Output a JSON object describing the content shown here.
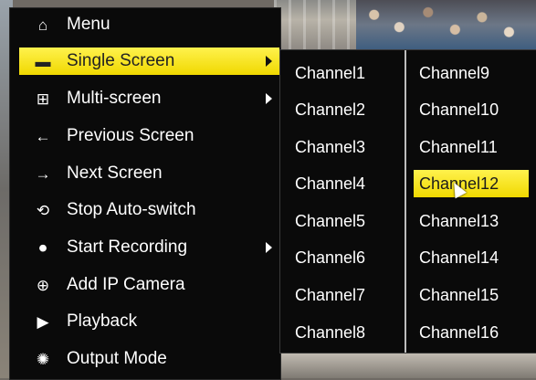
{
  "menu": {
    "items": [
      {
        "label": "Menu",
        "icon": "home-icon",
        "glyph": "⌂",
        "has_submenu": false,
        "selected": false
      },
      {
        "label": "Single Screen",
        "icon": "single-screen-icon",
        "glyph": "▬",
        "has_submenu": true,
        "selected": true
      },
      {
        "label": "Multi-screen",
        "icon": "multi-screen-icon",
        "glyph": "⊞",
        "has_submenu": true,
        "selected": false
      },
      {
        "label": "Previous Screen",
        "icon": "arrow-left-icon",
        "glyph": "←",
        "has_submenu": false,
        "selected": false
      },
      {
        "label": "Next Screen",
        "icon": "arrow-right-icon",
        "glyph": "→",
        "has_submenu": false,
        "selected": false
      },
      {
        "label": "Stop Auto-switch",
        "icon": "stop-auto-switch-icon",
        "glyph": "⟲",
        "has_submenu": false,
        "selected": false
      },
      {
        "label": "Start Recording",
        "icon": "record-icon",
        "glyph": "⏺",
        "has_submenu": true,
        "selected": false
      },
      {
        "label": "Add IP Camera",
        "icon": "add-camera-icon",
        "glyph": "⊕",
        "has_submenu": false,
        "selected": false
      },
      {
        "label": "Playback",
        "icon": "playback-icon",
        "glyph": "▶",
        "has_submenu": false,
        "selected": false
      },
      {
        "label": "Output Mode",
        "icon": "output-mode-icon",
        "glyph": "✺",
        "has_submenu": false,
        "selected": false
      }
    ]
  },
  "submenu": {
    "channels_left": [
      "Channel1",
      "Channel2",
      "Channel3",
      "Channel4",
      "Channel5",
      "Channel6",
      "Channel7",
      "Channel8"
    ],
    "channels_right": [
      "Channel9",
      "Channel10",
      "Channel11",
      "Channel12",
      "Channel13",
      "Channel14",
      "Channel15",
      "Channel16"
    ],
    "selected": "Channel12"
  },
  "colors": {
    "highlight": "#f5e21a",
    "menu_bg": "#0a0a0a",
    "text": "#ffffff"
  }
}
